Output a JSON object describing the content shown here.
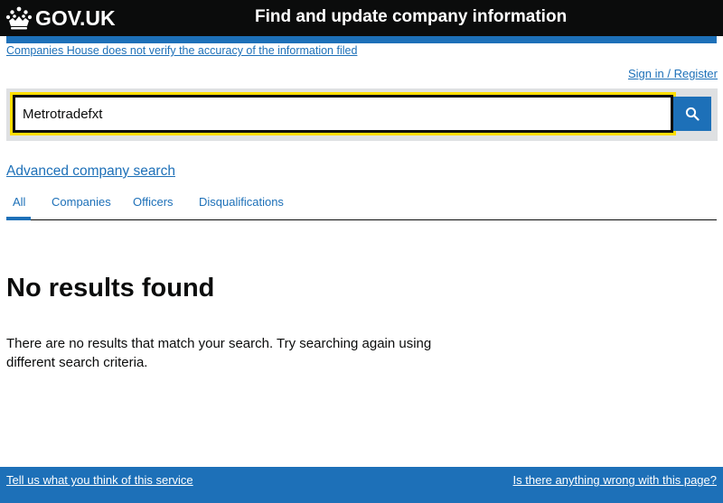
{
  "header": {
    "logo_text": "GOV.UK",
    "service_name": "Find and update company information"
  },
  "disclaimer": "Companies House does not verify the accuracy of the information filed",
  "account": {
    "sign_in_label": "Sign in / Register"
  },
  "search": {
    "value": "Metrotradefxt",
    "button_icon": "search-icon"
  },
  "advanced_search_label": "Advanced company search",
  "tabs": [
    {
      "label": "All",
      "selected": true
    },
    {
      "label": "Companies",
      "selected": false
    },
    {
      "label": "Officers",
      "selected": false
    },
    {
      "label": "Disqualifications",
      "selected": false
    }
  ],
  "results": {
    "heading": "No results found",
    "message": "There are no results that match your search. Try searching again using different search criteria."
  },
  "footer": {
    "feedback_link": "Tell us what you think of this service",
    "report_link": "Is there anything wrong with this page?"
  },
  "colors": {
    "header_bg": "#0b0c0c",
    "link_blue": "#1d70b8",
    "focus_yellow": "#ffdd00",
    "search_panel_bg": "#dee0e2"
  }
}
